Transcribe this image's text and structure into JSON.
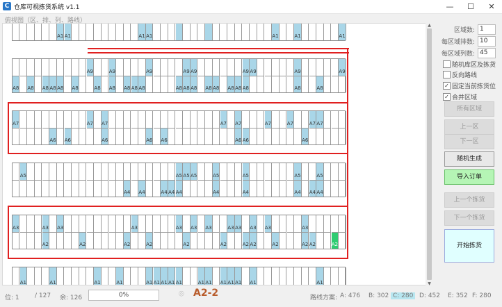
{
  "window": {
    "title": "仓库可视拣货系统 v1.1",
    "minimize": "—",
    "maximize": "☐",
    "close": "✕"
  },
  "view_label": "俯视图（区、排、列、路线）",
  "panel": {
    "zone_count_label": "区域数:",
    "zone_count": "1",
    "rows_per_zone_label": "每区域排数:",
    "rows_per_zone": "10",
    "cols_per_zone_label": "每区域列数:",
    "cols_per_zone": "45",
    "options": [
      {
        "label": "随机库区及拣货",
        "checked": false
      },
      {
        "label": "反向路线",
        "checked": false
      },
      {
        "label": "固定当前拣货位",
        "checked": true
      },
      {
        "label": "合并区域",
        "checked": true
      }
    ],
    "buttons": [
      "所有区域",
      "上一区",
      "下一区",
      "随机生成",
      "导入订单",
      "上一个拣货",
      "下一个拣货",
      "开始拣货"
    ]
  },
  "status": {
    "position": "位: 1",
    "total": "/ 127",
    "remaining": "余: 126",
    "progress": "0%",
    "progress_value": 0,
    "current": "A2-2",
    "scheme_label": "路线方案:",
    "schemes": [
      "A: 476",
      "B: 302",
      "C: 280",
      "D: 452",
      "E: 352",
      "F: 280"
    ],
    "selected_scheme": "C: 280"
  },
  "warehouse": {
    "rows": [
      {
        "top": [
          {
            "c": 6,
            "l": "A1"
          },
          {
            "c": 7,
            "l": "A1"
          },
          {
            "c": 17,
            "l": "A1"
          },
          {
            "c": 18,
            "l": "A1"
          },
          {
            "c": 22,
            "l": ""
          },
          {
            "c": 26,
            "l": ""
          },
          {
            "c": 35,
            "l": "A1"
          },
          {
            "c": 38,
            "l": "A1"
          },
          {
            "c": 44,
            "l": "A1"
          }
        ],
        "bottom": []
      },
      {
        "top": [
          {
            "c": 10,
            "l": "A9"
          },
          {
            "c": 13,
            "l": "A9"
          },
          {
            "c": 18,
            "l": "A9"
          },
          {
            "c": 23,
            "l": "A9"
          },
          {
            "c": 24,
            "l": "A9"
          },
          {
            "c": 31,
            "l": "A9"
          },
          {
            "c": 32,
            "l": "A9"
          },
          {
            "c": 38,
            "l": "A9"
          },
          {
            "c": 44,
            "l": "A9"
          }
        ],
        "bottom": [
          {
            "c": 0,
            "l": "A8"
          },
          {
            "c": 2,
            "l": "A8"
          },
          {
            "c": 4,
            "l": "A8"
          },
          {
            "c": 5,
            "l": "A8"
          },
          {
            "c": 6,
            "l": "A8"
          },
          {
            "c": 8,
            "l": "A8"
          },
          {
            "c": 11,
            "l": "A8"
          },
          {
            "c": 13,
            "l": "A8"
          },
          {
            "c": 15,
            "l": "A8"
          },
          {
            "c": 16,
            "l": "A8"
          },
          {
            "c": 17,
            "l": "A8"
          },
          {
            "c": 22,
            "l": "A8"
          },
          {
            "c": 23,
            "l": "A8"
          },
          {
            "c": 24,
            "l": "A8"
          },
          {
            "c": 26,
            "l": "A8"
          },
          {
            "c": 27,
            "l": "A8"
          },
          {
            "c": 29,
            "l": "A8"
          },
          {
            "c": 30,
            "l": "A8"
          },
          {
            "c": 31,
            "l": "A8"
          },
          {
            "c": 38,
            "l": "A8"
          },
          {
            "c": 41,
            "l": "A8"
          }
        ]
      },
      {
        "top": [
          {
            "c": 0,
            "l": "A7"
          },
          {
            "c": 10,
            "l": "A7"
          },
          {
            "c": 12,
            "l": "A7"
          },
          {
            "c": 28,
            "l": "A7"
          },
          {
            "c": 30,
            "l": "A7"
          },
          {
            "c": 34,
            "l": "A7"
          },
          {
            "c": 37,
            "l": "A7"
          },
          {
            "c": 40,
            "l": "A7"
          },
          {
            "c": 41,
            "l": "A7"
          }
        ],
        "bottom": [
          {
            "c": 5,
            "l": "A6"
          },
          {
            "c": 7,
            "l": "A6"
          },
          {
            "c": 12,
            "l": "A6"
          },
          {
            "c": 18,
            "l": "A6"
          },
          {
            "c": 20,
            "l": "A6"
          },
          {
            "c": 30,
            "l": "A6"
          },
          {
            "c": 31,
            "l": "A6"
          },
          {
            "c": 39,
            "l": "A6"
          }
        ]
      },
      {
        "top": [
          {
            "c": 1,
            "l": "A5"
          },
          {
            "c": 22,
            "l": "A5"
          },
          {
            "c": 23,
            "l": "A5"
          },
          {
            "c": 24,
            "l": "A5"
          },
          {
            "c": 27,
            "l": "A5"
          },
          {
            "c": 31,
            "l": "A5"
          },
          {
            "c": 38,
            "l": "A5"
          },
          {
            "c": 41,
            "l": "A5"
          }
        ],
        "bottom": [
          {
            "c": 15,
            "l": "A4"
          },
          {
            "c": 17,
            "l": "A4"
          },
          {
            "c": 20,
            "l": "A4"
          },
          {
            "c": 21,
            "l": "A4"
          },
          {
            "c": 22,
            "l": "A4"
          },
          {
            "c": 27,
            "l": "A4"
          },
          {
            "c": 31,
            "l": "A4"
          },
          {
            "c": 38,
            "l": "A4"
          },
          {
            "c": 40,
            "l": "A4"
          },
          {
            "c": 41,
            "l": "A4"
          }
        ]
      },
      {
        "top": [
          {
            "c": 0,
            "l": "A3"
          },
          {
            "c": 4,
            "l": "A3"
          },
          {
            "c": 6,
            "l": "A3"
          },
          {
            "c": 16,
            "l": "A3"
          },
          {
            "c": 22,
            "l": "A3"
          },
          {
            "c": 24,
            "l": "A3"
          },
          {
            "c": 26,
            "l": "A3"
          },
          {
            "c": 29,
            "l": "A3"
          },
          {
            "c": 30,
            "l": "A3"
          },
          {
            "c": 32,
            "l": "A3"
          },
          {
            "c": 34,
            "l": "A3"
          },
          {
            "c": 39,
            "l": "A3"
          }
        ],
        "bottom": [
          {
            "c": 4,
            "l": "A2"
          },
          {
            "c": 9,
            "l": "A2"
          },
          {
            "c": 15,
            "l": "A2"
          },
          {
            "c": 18,
            "l": "A2"
          },
          {
            "c": 23,
            "l": "A2"
          },
          {
            "c": 28,
            "l": "A2"
          },
          {
            "c": 31,
            "l": "A2"
          },
          {
            "c": 32,
            "l": "A2"
          },
          {
            "c": 35,
            "l": "A2"
          },
          {
            "c": 39,
            "l": "A2"
          },
          {
            "c": 40,
            "l": "A2"
          },
          {
            "c": 43,
            "l": "A2",
            "current": true
          }
        ]
      },
      {
        "top": [],
        "bottom": [
          {
            "c": 1,
            "l": "A1"
          },
          {
            "c": 5,
            "l": "A1"
          },
          {
            "c": 11,
            "l": "A1"
          },
          {
            "c": 14,
            "l": "A1"
          },
          {
            "c": 18,
            "l": "A1"
          },
          {
            "c": 19,
            "l": "A1"
          },
          {
            "c": 20,
            "l": "A1"
          },
          {
            "c": 21,
            "l": "A1"
          },
          {
            "c": 22,
            "l": "A1"
          },
          {
            "c": 25,
            "l": "A1"
          },
          {
            "c": 26,
            "l": "A1"
          },
          {
            "c": 28,
            "l": "A1"
          },
          {
            "c": 29,
            "l": "A1"
          },
          {
            "c": 30,
            "l": "A1"
          },
          {
            "c": 32,
            "l": "A1"
          },
          {
            "c": 41,
            "l": "A1"
          }
        ]
      }
    ]
  }
}
